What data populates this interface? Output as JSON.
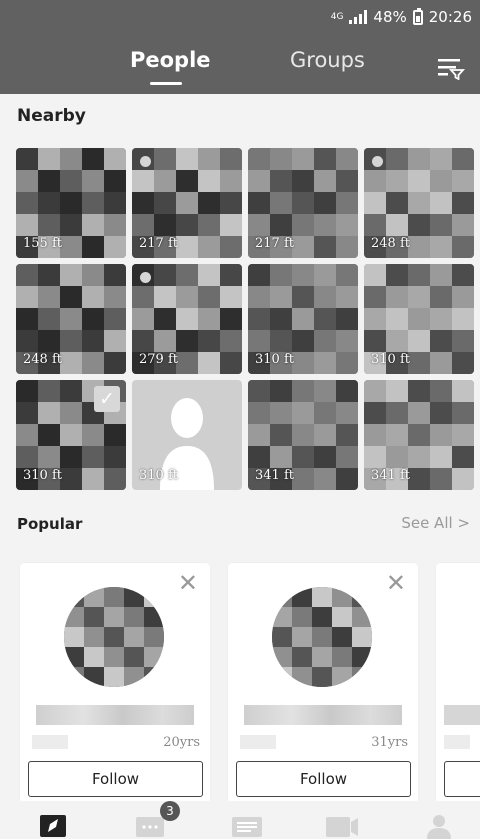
{
  "status_bar": {
    "network": "4G",
    "battery": "48%",
    "time": "20:26"
  },
  "header": {
    "tabs": [
      {
        "label": "People",
        "active": true
      },
      {
        "label": "Groups",
        "active": false
      }
    ]
  },
  "nearby": {
    "title": "Nearby",
    "tiles": [
      {
        "distance": "155 ft",
        "online": false,
        "checked": false
      },
      {
        "distance": "217 ft",
        "online": true,
        "checked": false
      },
      {
        "distance": "217 ft",
        "online": false,
        "checked": false
      },
      {
        "distance": "248 ft",
        "online": true,
        "checked": false
      },
      {
        "distance": "248 ft",
        "online": false,
        "checked": false
      },
      {
        "distance": "279 ft",
        "online": true,
        "checked": false
      },
      {
        "distance": "310 ft",
        "online": false,
        "checked": false
      },
      {
        "distance": "310 ft",
        "online": false,
        "checked": false
      },
      {
        "distance": "310 ft",
        "online": false,
        "checked": true
      },
      {
        "distance": "310 ft",
        "online": false,
        "checked": false,
        "placeholder": true
      },
      {
        "distance": "341 ft",
        "online": false,
        "checked": false
      },
      {
        "distance": "341 ft",
        "online": false,
        "checked": false
      }
    ]
  },
  "popular": {
    "title": "Popular",
    "see_all": "See All >",
    "cards": [
      {
        "age": "20yrs",
        "follow_label": "Follow",
        "close": "✕"
      },
      {
        "age": "31yrs",
        "follow_label": "Follow",
        "close": "✕"
      }
    ]
  },
  "bottom_nav": {
    "messages_badge": "3"
  },
  "colors": {
    "header_bg": "#616161",
    "page_bg": "#f3f3f3",
    "card_bg": "#ffffff"
  }
}
